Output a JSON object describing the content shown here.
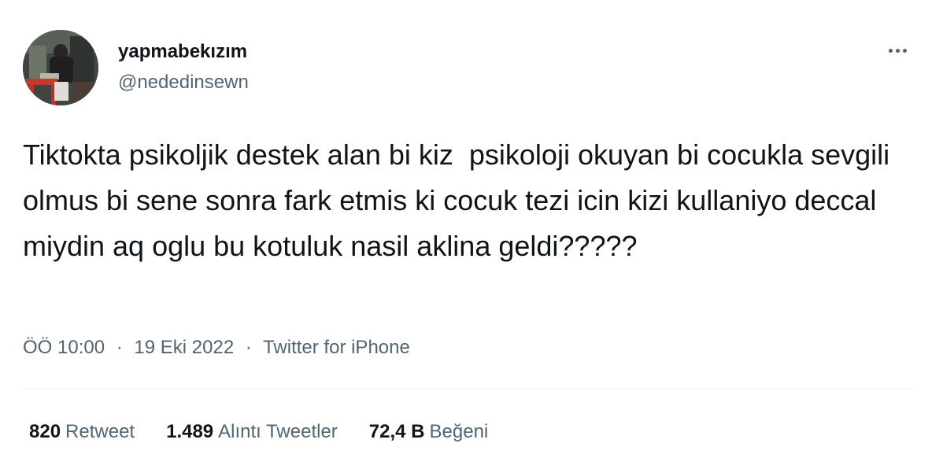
{
  "user": {
    "display_name": "yapmabekızım",
    "handle": "@nededinsewn",
    "avatar_icon": "profile-photo"
  },
  "menu": {
    "icon": "more-options-icon"
  },
  "tweet": {
    "text": "Tiktokta psikoljik destek alan bi kiz  psikoloji okuyan bi cocukla sevgili olmus bi sene sonra fark etmis ki cocuk tezi icin kizi kullaniyo deccal miydin aq oglu bu kotuluk nasil aklina geldi?????",
    "time": "ÖÖ 10:00",
    "date": "19 Eki 2022",
    "separator": "·",
    "source": "Twitter for iPhone"
  },
  "stats": [
    {
      "count": "820",
      "label": "Retweet"
    },
    {
      "count": "1.489",
      "label": "Alıntı Tweetler"
    },
    {
      "count": "72,4 B",
      "label": "Beğeni"
    }
  ],
  "colors": {
    "text_primary": "#0f1419",
    "text_secondary": "#536471",
    "divider": "#eff3f4"
  }
}
